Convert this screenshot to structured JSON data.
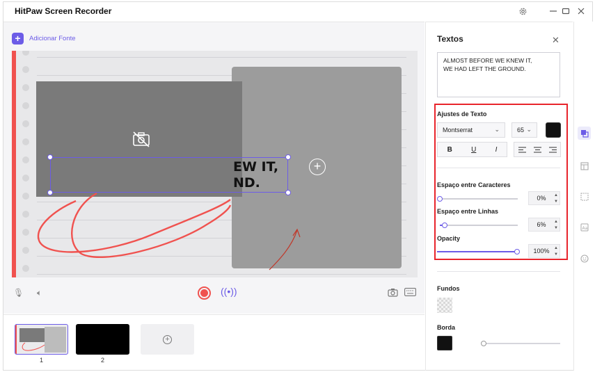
{
  "app": {
    "title": "HitPaw Screen Recorder"
  },
  "titlebar": {
    "settings_icon": "gear-icon",
    "minimize_icon": "minimize-icon",
    "maximize_icon": "maximize-icon",
    "close_icon": "close-icon"
  },
  "editor": {
    "add_font_label": "Adicionar Fonte",
    "canvas_text": "EW IT,\nND.",
    "controls": {
      "mic_icon": "microphone-icon",
      "speaker_icon": "speaker-icon",
      "record_icon": "record-icon",
      "live_icon": "broadcast-icon",
      "camera_icon": "camera-icon",
      "keyboard_icon": "keyboard-icon"
    }
  },
  "thumbnails": [
    {
      "number": "1",
      "selected": true
    },
    {
      "number": "2",
      "selected": false
    }
  ],
  "panel": {
    "title": "Textos",
    "text_value": "ALMOST BEFORE WE KNEW IT,\nWE HAD LEFT THE GROUND.",
    "text_settings": {
      "title": "Ajustes de Texto",
      "font": "Montserrat",
      "size": "65",
      "color": "#111111",
      "bold": "B",
      "underline": "U",
      "italic": "I"
    },
    "char_spacing": {
      "label": "Espaço entre Caracteres",
      "value": "0%",
      "level": 0
    },
    "line_spacing": {
      "label": "Espaço entre Linhas",
      "value": "6%",
      "level": 0.06
    },
    "opacity": {
      "label": "Opacity",
      "value": "100%",
      "level": 1
    },
    "backgrounds": {
      "label": "Fundos"
    },
    "border": {
      "label": "Borda",
      "color": "#111111"
    }
  },
  "rail": [
    "layers-icon",
    "layout-icon",
    "pattern-icon",
    "text-icon",
    "emoji-icon"
  ],
  "colors": {
    "accent": "#6c5ce7",
    "record": "#f0524f",
    "highlight": "#e8242b"
  }
}
